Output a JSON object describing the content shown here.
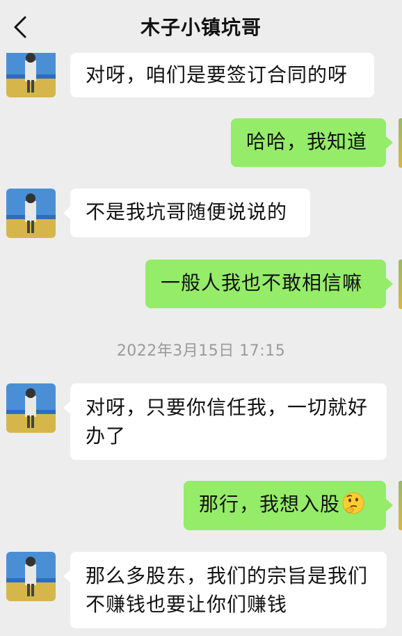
{
  "header": {
    "title": "木子小镇坑哥"
  },
  "timestamp": "2022年3月15日 17:15",
  "messages": [
    {
      "side": "in",
      "text": "对呀，咱们是要签订合同的呀"
    },
    {
      "side": "out",
      "text": "哈哈，我知道"
    },
    {
      "side": "in",
      "text": "不是我坑哥随便说说的"
    },
    {
      "side": "out",
      "text": "一般人我也不敢相信嘛"
    },
    {
      "side": "in",
      "text_line1": "对呀，只要你信任我，一切就好",
      "text_line2": "办了"
    },
    {
      "side": "out",
      "text": "那行，我想入股",
      "emoji": "thinking-face"
    },
    {
      "side": "in",
      "text_line1": "那么多股东，我们的宗旨是我们",
      "text_line2": "不赚钱也要让你们赚钱"
    }
  ]
}
